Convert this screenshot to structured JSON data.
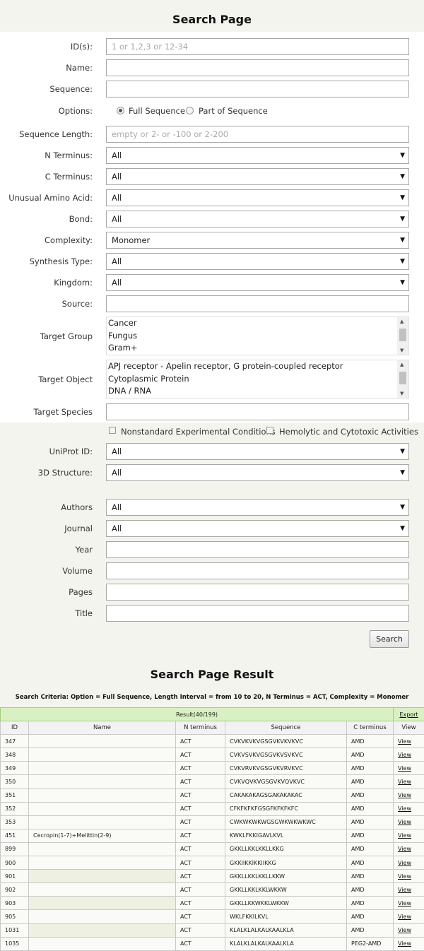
{
  "page_title": "Search Page",
  "form": {
    "ids": {
      "label": "ID(s):",
      "placeholder": "1 or 1,2,3 or 12-34"
    },
    "name": {
      "label": "Name:"
    },
    "sequence": {
      "label": "Sequence:"
    },
    "options": {
      "label": "Options:",
      "full": "Full Sequence",
      "part": "Part of Sequence",
      "selected": "Full Sequence"
    },
    "seq_length": {
      "label": "Sequence Length:",
      "placeholder": "empty  or 2- or -100 or 2-200"
    },
    "n_terminus": {
      "label": "N Terminus:",
      "value": "All"
    },
    "c_terminus": {
      "label": "C Terminus:",
      "value": "All"
    },
    "unusual_aa": {
      "label": "Unusual Amino Acid:",
      "value": "All"
    },
    "bond": {
      "label": "Bond:",
      "value": "All"
    },
    "complexity": {
      "label": "Complexity:",
      "value": "Monomer"
    },
    "synthesis_type": {
      "label": "Synthesis Type:",
      "value": "All"
    },
    "kingdom": {
      "label": "Kingdom:",
      "value": "All"
    },
    "source": {
      "label": "Source:"
    },
    "target_group": {
      "label": "Target Group",
      "items": [
        "Cancer",
        "Fungus",
        "Gram+"
      ]
    },
    "target_object": {
      "label": "Target Object",
      "items": [
        "APJ receptor - Apelin receptor, G protein-coupled receptor",
        "Cytoplasmic Protein",
        "DNA / RNA"
      ]
    },
    "target_species": {
      "label": "Target Species"
    },
    "nonstandard": "Nonstandard Experimental Conditions",
    "hemolytic": "Hemolytic and Cytotoxic Activities",
    "uniprot": {
      "label": "UniProt ID:",
      "value": "All"
    },
    "structure_3d": {
      "label": "3D Structure:",
      "value": "All"
    },
    "authors": {
      "label": "Authors",
      "value": "All"
    },
    "journal": {
      "label": "Journal",
      "value": "All"
    },
    "year": {
      "label": "Year"
    },
    "volume": {
      "label": "Volume"
    },
    "pages": {
      "label": "Pages"
    },
    "title": {
      "label": "Title"
    },
    "search_button": "Search"
  },
  "results": {
    "heading": "Search Page Result",
    "criteria": "Search Criteria: Option = Full Sequence, Length Interval = from 10 to 20, N Terminus = ACT, Complexity = Monomer",
    "summary": "Result(40/199)",
    "export": "Export",
    "columns": [
      "ID",
      "Name",
      "N terminus",
      "Sequence",
      "C terminus",
      "View"
    ],
    "rows": [
      [
        "347",
        "",
        "ACT",
        "CVKVKVKVGSGVKVKVKVC",
        "AMD",
        "View"
      ],
      [
        "348",
        "",
        "ACT",
        "CVKVSVKVGSGVKVSVKVC",
        "AMD",
        "View"
      ],
      [
        "349",
        "",
        "ACT",
        "CVKVRVKVGSGVKVRVKVC",
        "AMD",
        "View"
      ],
      [
        "350",
        "",
        "ACT",
        "CVKVQVKVGSGVKVQVKVC",
        "AMD",
        "View"
      ],
      [
        "351",
        "",
        "ACT",
        "CAKAKAKAGSGAKAKAKAC",
        "AMD",
        "View"
      ],
      [
        "352",
        "",
        "ACT",
        "CFKFKFKFGSGFKFKFKFC",
        "AMD",
        "View"
      ],
      [
        "353",
        "",
        "ACT",
        "CWKWKWKWGSGWKWKWKWC",
        "AMD",
        "View"
      ],
      [
        "451",
        "Cecropin(1-7)+Melittin(2-9)",
        "ACT",
        "KWKLFKKIGAVLKVL",
        "AMD",
        "View"
      ],
      [
        "899",
        "",
        "ACT",
        "GKKLLKKLKKLLKKG",
        "AMD",
        "View"
      ],
      [
        "900",
        "",
        "ACT",
        "GKKlIKKlKKlIKKG",
        "AMD",
        "View"
      ],
      [
        "901",
        "",
        "ACT",
        "GKKLLKKLKKLLKKW",
        "AMD",
        "View"
      ],
      [
        "902",
        "",
        "ACT",
        "GKKLLKKLKKLWKKW",
        "AMD",
        "View"
      ],
      [
        "903",
        "",
        "ACT",
        "GKKLLKKWKKLWKKW",
        "AMD",
        "View"
      ],
      [
        "905",
        "",
        "ACT",
        "WKLFKKILKVL",
        "AMD",
        "View"
      ],
      [
        "1031",
        "",
        "ACT",
        "KLALKLALKALKAALKLA",
        "AMD",
        "View"
      ],
      [
        "1035",
        "",
        "ACT",
        "KLALKLALKALKAALKLA",
        "PEG2-AMD",
        "View"
      ]
    ]
  }
}
